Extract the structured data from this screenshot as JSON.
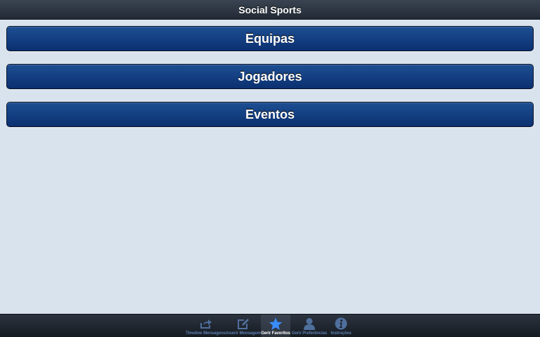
{
  "header": {
    "title": "Social Sports"
  },
  "menu": {
    "items": [
      {
        "label": "Equipas"
      },
      {
        "label": "Jogadores"
      },
      {
        "label": "Eventos"
      }
    ]
  },
  "tabbar": {
    "tabs": [
      {
        "label": "Timeline Mensagens",
        "icon": "share-icon",
        "active": false
      },
      {
        "label": "Inserir Mensagem",
        "icon": "compose-icon",
        "active": false
      },
      {
        "label": "Gerir Favoritos",
        "icon": "star-icon",
        "active": true
      },
      {
        "label": "Gerir Preferências",
        "icon": "user-icon",
        "active": false
      },
      {
        "label": "Instruções",
        "icon": "info-icon",
        "active": false
      }
    ]
  },
  "colors": {
    "background": "#d9e3ee",
    "button_blue": "#0b3070",
    "tab_inactive": "#5d7fb0",
    "tab_active_icon": "#3a8dff"
  }
}
